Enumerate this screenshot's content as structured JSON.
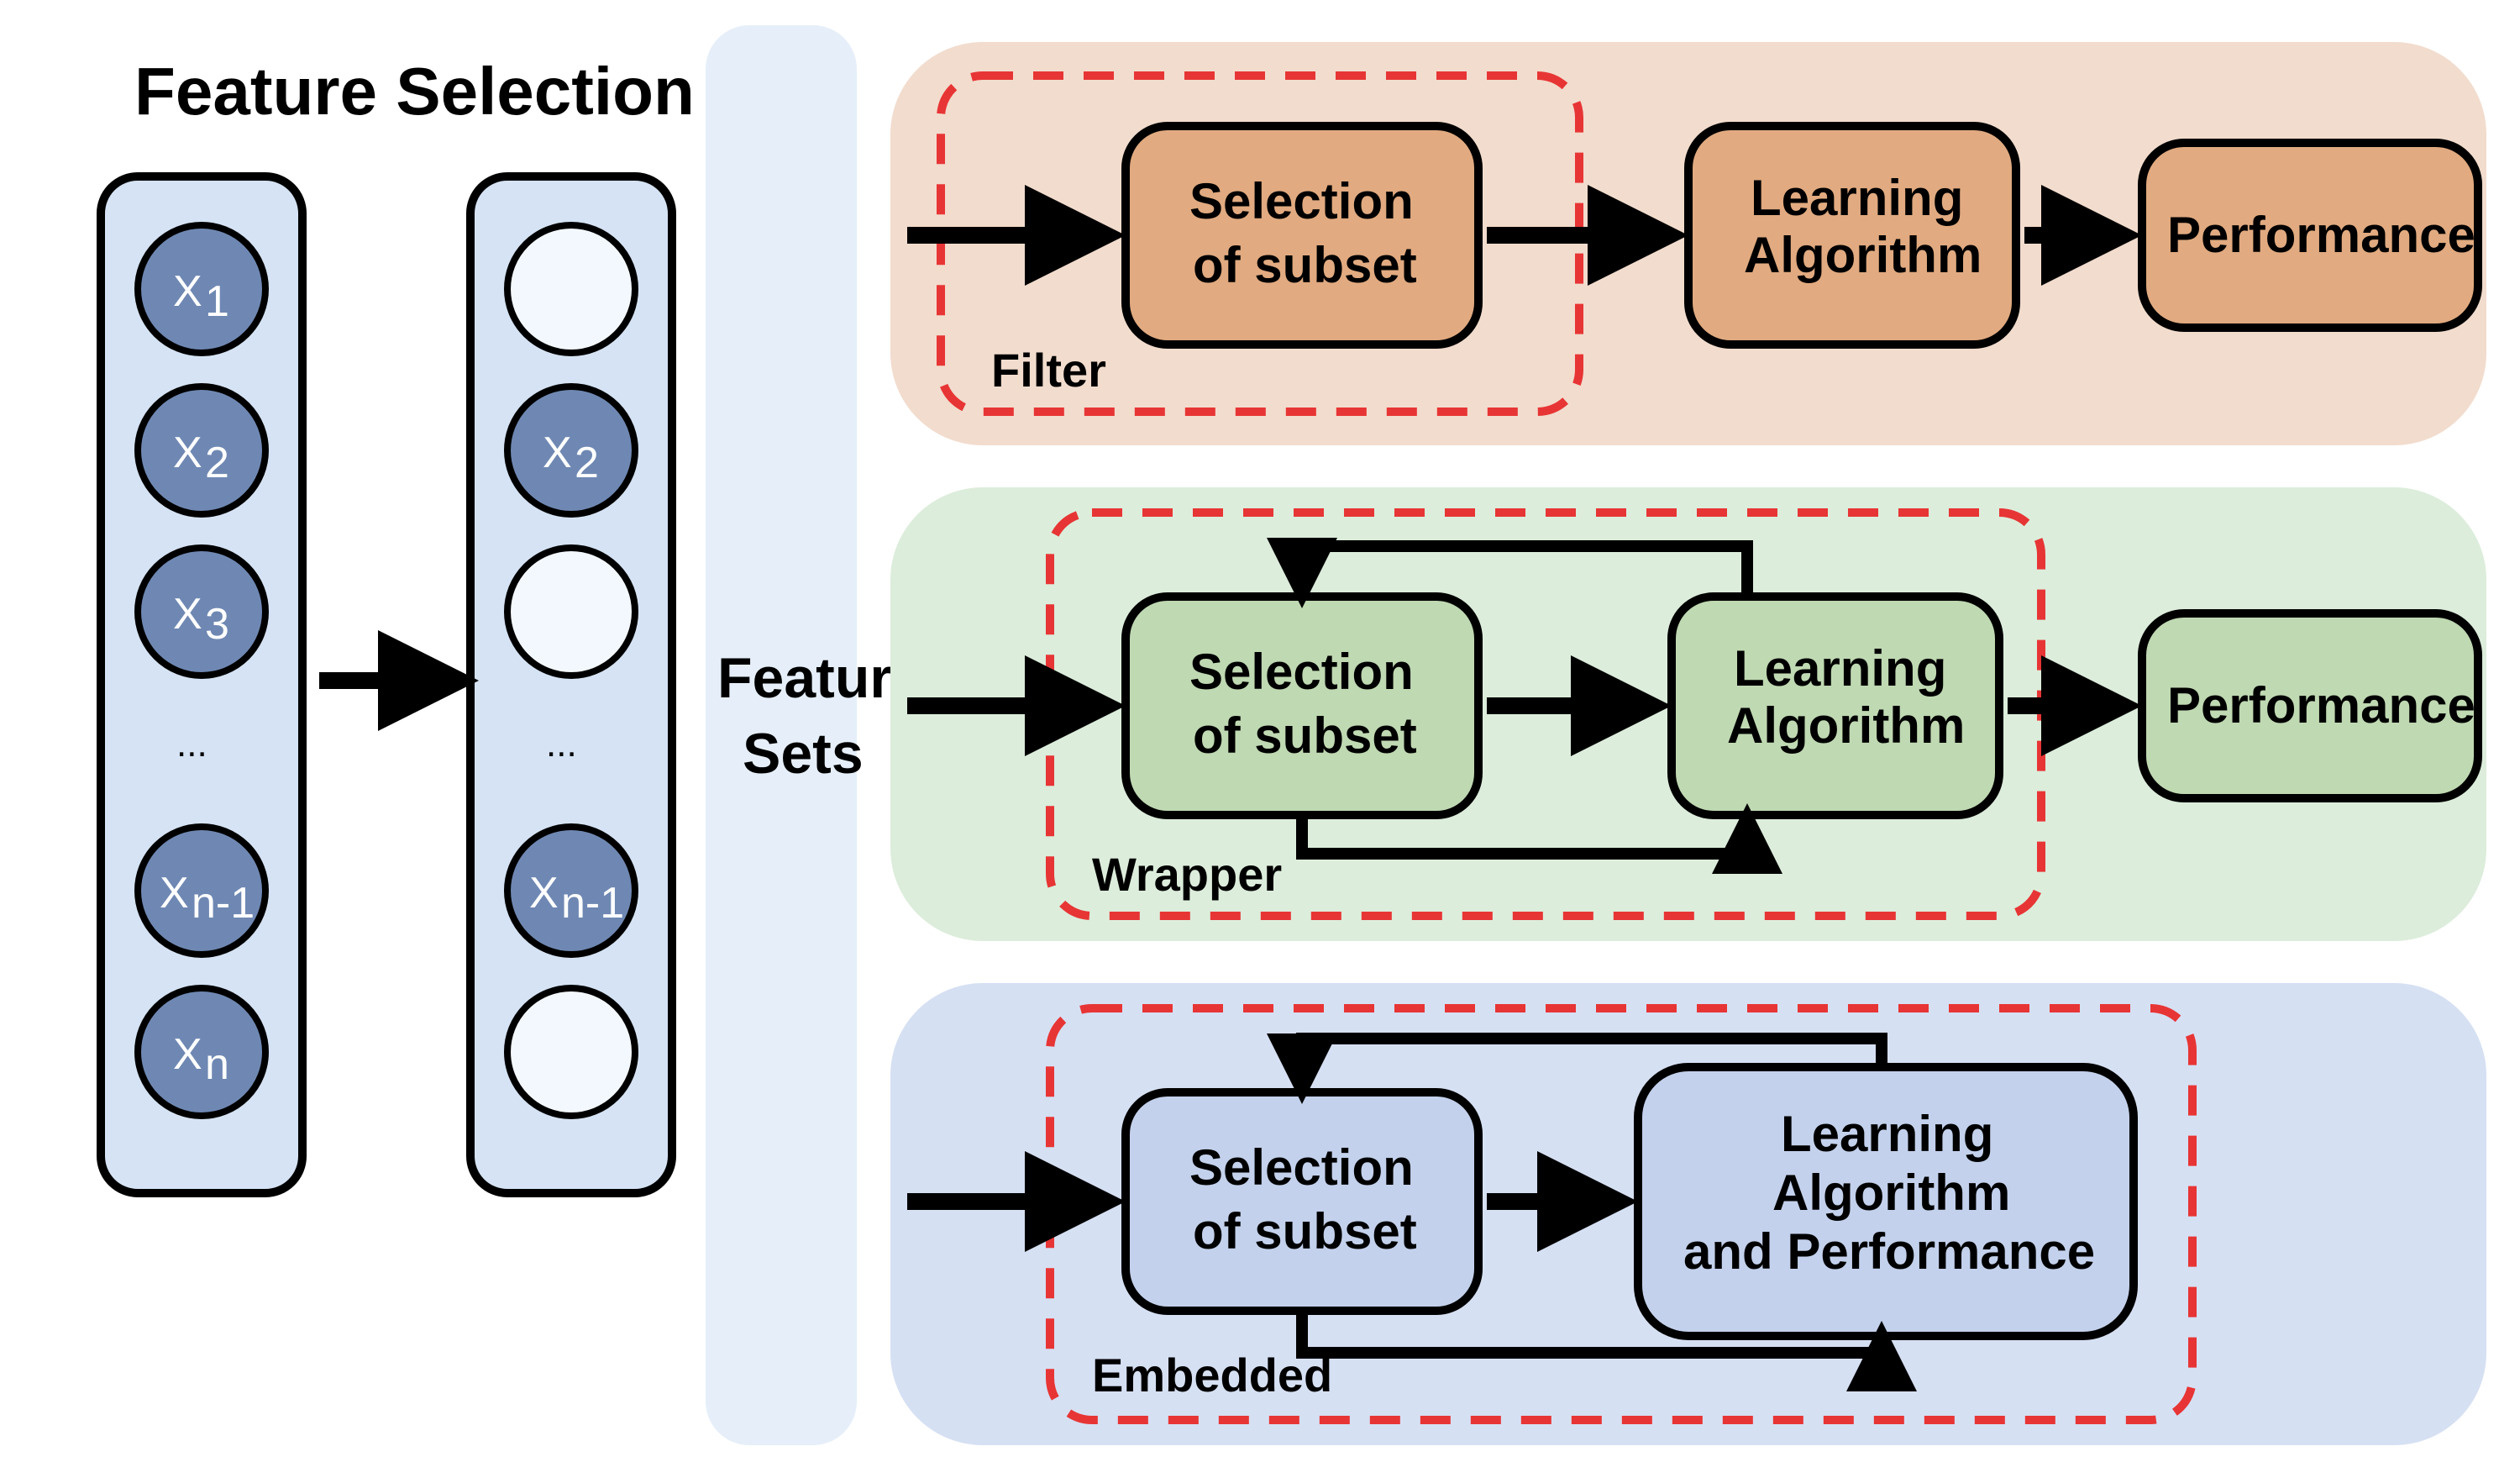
{
  "title": "Feature Selection",
  "mid_label_1": "Feature",
  "mid_label_2": "Sets",
  "features_left": [
    "X",
    "X",
    "X",
    "...",
    "X",
    "X"
  ],
  "features_left_sub": [
    "1",
    "2",
    "3",
    "",
    "n-1",
    "n"
  ],
  "features_right_filled": [
    false,
    true,
    false,
    false,
    true,
    false
  ],
  "features_right_labels": [
    "",
    "X",
    "",
    "...",
    "X",
    ""
  ],
  "features_right_sub": [
    "",
    "2",
    "",
    "",
    "n-1",
    ""
  ],
  "filter": {
    "label": "Filter",
    "box1_l1": "Selection",
    "box1_l2": "of subset",
    "box2_l1": "Learning",
    "box2_l2": "Algorithm",
    "box3": "Performance"
  },
  "wrapper": {
    "label": "Wrapper",
    "box1_l1": "Selection",
    "box1_l2": "of subset",
    "box2_l1": "Learning",
    "box2_l2": "Algorithm",
    "box3": "Performance"
  },
  "embedded": {
    "label": "Embedded",
    "box1_l1": "Selection",
    "box1_l2": "of subset",
    "box2_l1": "Learning",
    "box2_l2": "Algorithm",
    "box2_l3": "and Performance"
  },
  "colors": {
    "blue_bg": "#d5e3f4",
    "blue_node": "#c0d4ed",
    "blue_circle_filled": "#6f88b3",
    "blue_circle_empty": "#f3f8fe",
    "orange_bg": "#f2dccd",
    "orange_node": "#e1aa80",
    "green_bg": "#dceddb",
    "green_node": "#bfd9b2",
    "emb_bg": "#d6e0f3",
    "emb_node": "#c3d1ec"
  }
}
